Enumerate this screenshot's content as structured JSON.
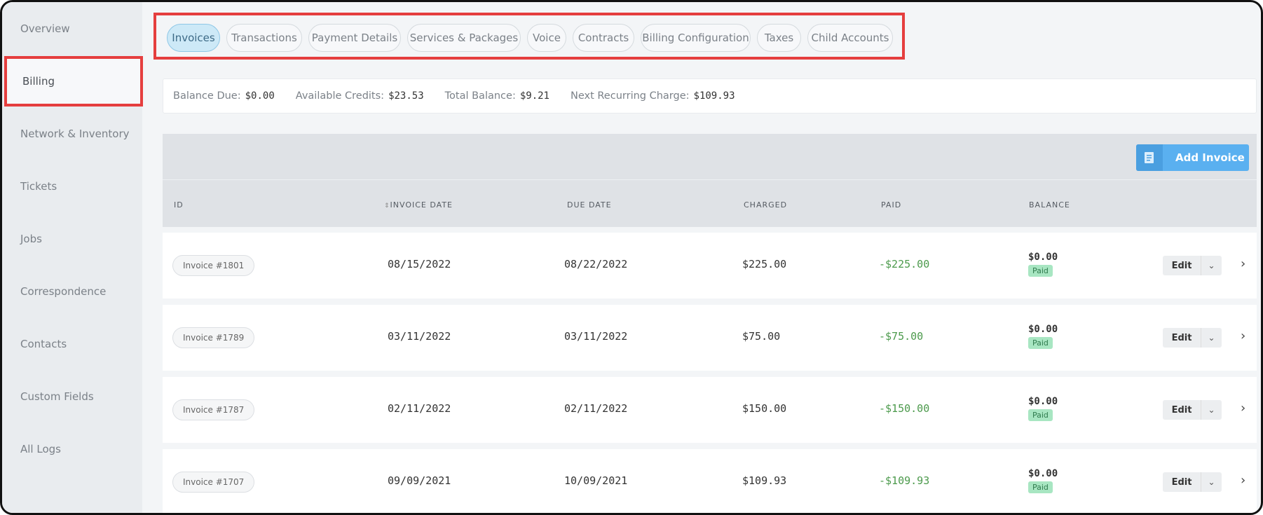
{
  "sidebar": {
    "items": [
      {
        "label": "Overview"
      },
      {
        "label": "Billing"
      },
      {
        "label": "Network & Inventory"
      },
      {
        "label": "Tickets"
      },
      {
        "label": "Jobs"
      },
      {
        "label": "Correspondence"
      },
      {
        "label": "Contacts"
      },
      {
        "label": "Custom Fields"
      },
      {
        "label": "All Logs"
      }
    ],
    "active_index": 1
  },
  "tabs": [
    {
      "label": "Invoices"
    },
    {
      "label": "Transactions"
    },
    {
      "label": "Payment Details"
    },
    {
      "label": "Services & Packages"
    },
    {
      "label": "Voice"
    },
    {
      "label": "Contracts"
    },
    {
      "label": "Billing Configuration"
    },
    {
      "label": "Taxes"
    },
    {
      "label": "Child Accounts"
    }
  ],
  "summary": {
    "balance_due_label": "Balance Due:",
    "balance_due": "$0.00",
    "available_credits_label": "Available Credits:",
    "available_credits": "$23.53",
    "total_balance_label": "Total Balance:",
    "total_balance": "$9.21",
    "next_recurring_label": "Next Recurring Charge:",
    "next_recurring": "$109.93"
  },
  "table": {
    "add_button": "Add Invoice",
    "headers": {
      "id": "ID",
      "invoice_date": "INVOICE DATE",
      "due_date": "DUE DATE",
      "charged": "CHARGED",
      "paid": "PAID",
      "balance": "BALANCE"
    },
    "edit_label": "Edit",
    "rows": [
      {
        "id": "Invoice #1801",
        "invoice_date": "08/15/2022",
        "due_date": "08/22/2022",
        "charged": "$225.00",
        "paid": "-$225.00",
        "balance": "$0.00",
        "status": "Paid"
      },
      {
        "id": "Invoice #1789",
        "invoice_date": "03/11/2022",
        "due_date": "03/11/2022",
        "charged": "$75.00",
        "paid": "-$75.00",
        "balance": "$0.00",
        "status": "Paid"
      },
      {
        "id": "Invoice #1787",
        "invoice_date": "02/11/2022",
        "due_date": "02/11/2022",
        "charged": "$150.00",
        "paid": "-$150.00",
        "balance": "$0.00",
        "status": "Paid"
      },
      {
        "id": "Invoice #1707",
        "invoice_date": "09/09/2021",
        "due_date": "10/09/2021",
        "charged": "$109.93",
        "paid": "-$109.93",
        "balance": "$0.00",
        "status": "Paid"
      }
    ]
  },
  "colors": {
    "accent": "#5ab0f0",
    "highlight": "#e53e3e",
    "paid_text": "#4c9a4c",
    "paid_badge": "#a8e6c2"
  }
}
